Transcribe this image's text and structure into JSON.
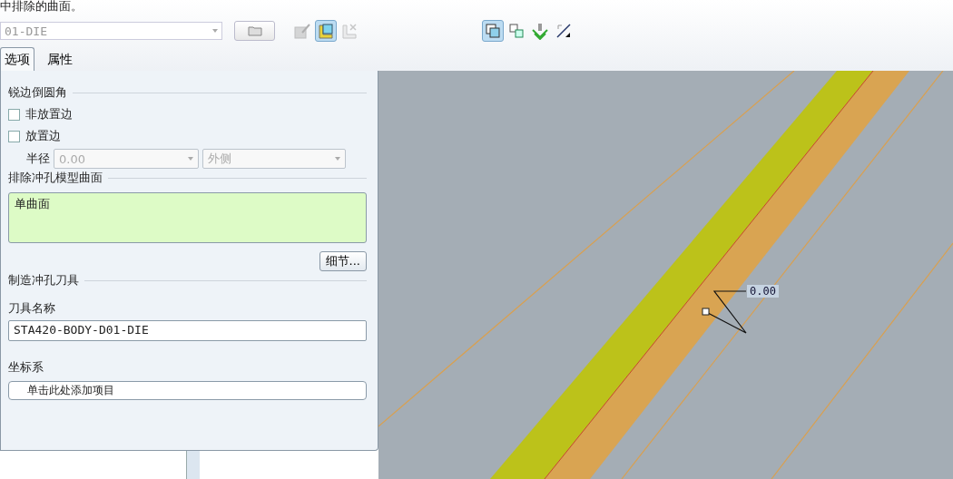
{
  "instruction": "中排除的曲面。",
  "toolbar": {
    "tool_combo": {
      "value": "01-DIE"
    },
    "left_icons": [
      {
        "kind": "edit",
        "pressed": false,
        "disabled": true
      },
      {
        "kind": "fill",
        "pressed": true,
        "disabled": false
      },
      {
        "kind": "remove",
        "pressed": false,
        "disabled": true
      }
    ],
    "right_icons": [
      {
        "kind": "copy",
        "pressed": true,
        "disabled": false
      },
      {
        "kind": "tree",
        "pressed": false,
        "disabled": false
      },
      {
        "kind": "punch",
        "pressed": false,
        "disabled": false
      },
      {
        "kind": "flip",
        "pressed": false,
        "disabled": false
      }
    ]
  },
  "tabs": [
    {
      "label": "选项",
      "selected": true
    },
    {
      "label": "属性",
      "selected": false
    }
  ],
  "panel": {
    "edge_section": "锐边倒圆角",
    "checkboxes": [
      {
        "label": "非放置边",
        "checked": false
      },
      {
        "label": "放置边",
        "checked": false
      }
    ],
    "radius": {
      "label": "半径",
      "value": "0.00",
      "side": "外侧",
      "disabled": true
    },
    "exclude_section": "排除冲孔模型曲面",
    "exclude_collector": "单曲面",
    "details_button": "细节...",
    "tool_section": "制造冲孔刀具",
    "tool_name_label": "刀具名称",
    "tool_name": "STA420-BODY-D01-DIE",
    "csys_label": "坐标系",
    "csys_collector": "单击此处添加项目"
  },
  "viewport": {
    "dimension": "0.00"
  }
}
